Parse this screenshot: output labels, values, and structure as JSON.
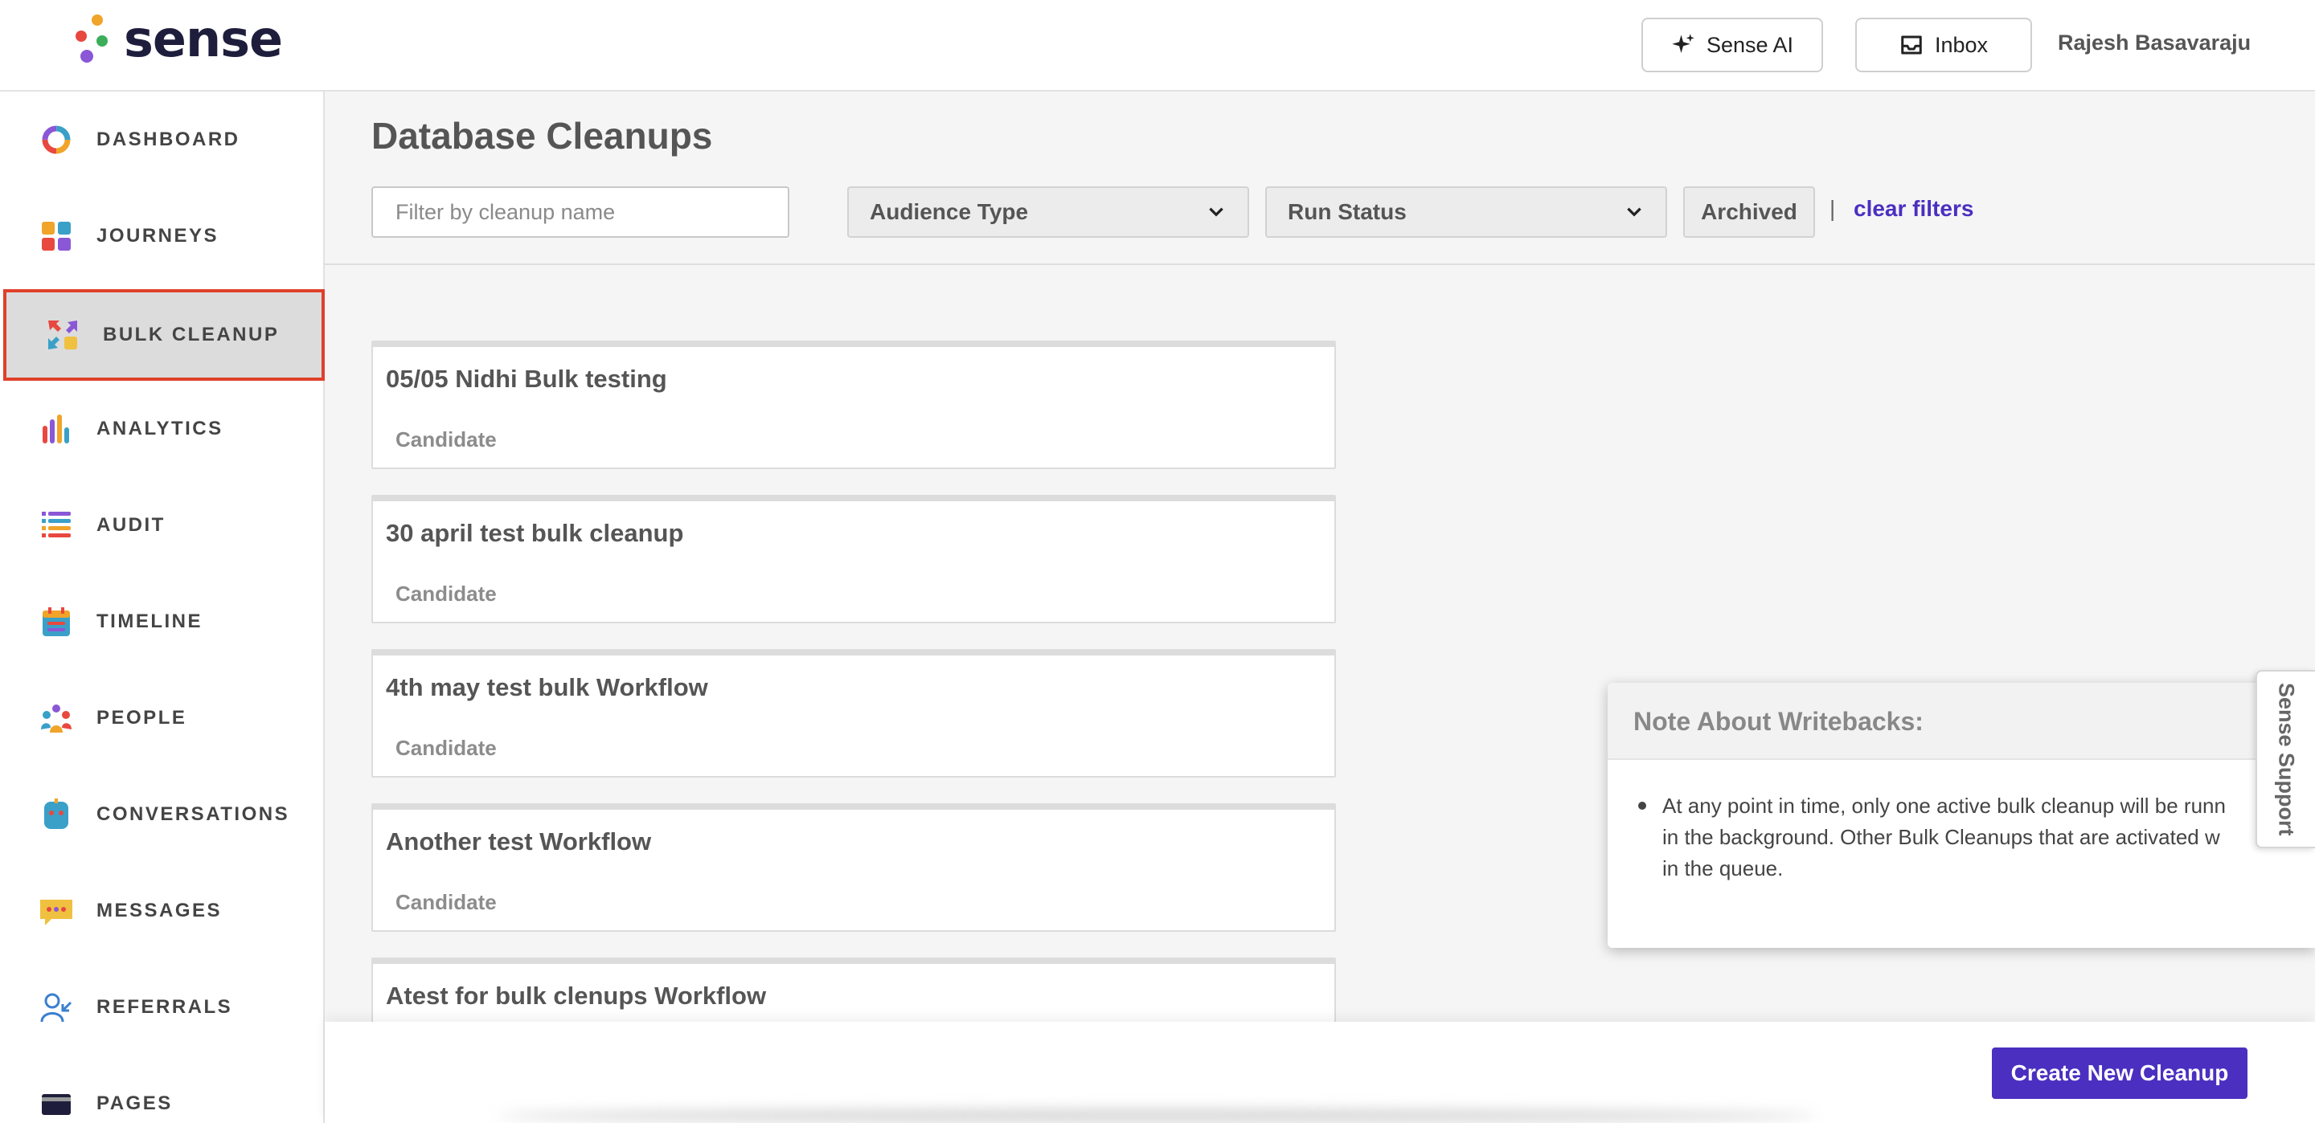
{
  "brand": {
    "name": "sense"
  },
  "header": {
    "ai_label": "Sense AI",
    "inbox_label": "Inbox",
    "user_name": "Rajesh Basavaraju"
  },
  "sidebar": {
    "items": [
      {
        "label": "DASHBOARD",
        "icon": "dashboard-donut-icon"
      },
      {
        "label": "JOURNEYS",
        "icon": "journeys-grid-icon"
      },
      {
        "label": "BULK CLEANUP",
        "icon": "bulk-cleanup-arrows-icon",
        "active": true
      },
      {
        "label": "ANALYTICS",
        "icon": "analytics-bars-icon"
      },
      {
        "label": "AUDIT",
        "icon": "audit-list-icon"
      },
      {
        "label": "TIMELINE",
        "icon": "timeline-calendar-icon"
      },
      {
        "label": "PEOPLE",
        "icon": "people-group-icon"
      },
      {
        "label": "CONVERSATIONS",
        "icon": "conversations-bot-icon"
      },
      {
        "label": "MESSAGES",
        "icon": "messages-bubble-icon"
      },
      {
        "label": "REFERRALS",
        "icon": "referrals-user-icon"
      },
      {
        "label": "PAGES",
        "icon": "pages-card-icon"
      }
    ]
  },
  "main": {
    "title": "Database Cleanups",
    "filter_placeholder": "Filter by cleanup name",
    "audience_type": "Audience Type",
    "run_status": "Run Status",
    "archived_label": "Archived",
    "separator": "|",
    "clear_filters": "clear filters",
    "cleanups": [
      {
        "name": "05/05 Nidhi Bulk testing",
        "audience": "Candidate"
      },
      {
        "name": "30 april test bulk cleanup",
        "audience": "Candidate"
      },
      {
        "name": "4th may test bulk Workflow",
        "audience": "Candidate"
      },
      {
        "name": "Another test Workflow",
        "audience": "Candidate"
      },
      {
        "name": "Atest for bulk clenups Workflow",
        "audience": ""
      }
    ]
  },
  "note": {
    "title": "Note About Writebacks:",
    "lines": [
      "At any point in time, only one active bulk cleanup will be runn",
      "in the background. Other Bulk Cleanups that are activated w",
      "in the queue."
    ]
  },
  "support": {
    "label": "Sense Support"
  },
  "footer": {
    "create_label": "Create New Cleanup"
  },
  "colors": {
    "accent": "#4b2fc0",
    "active_border": "#e0402a"
  }
}
